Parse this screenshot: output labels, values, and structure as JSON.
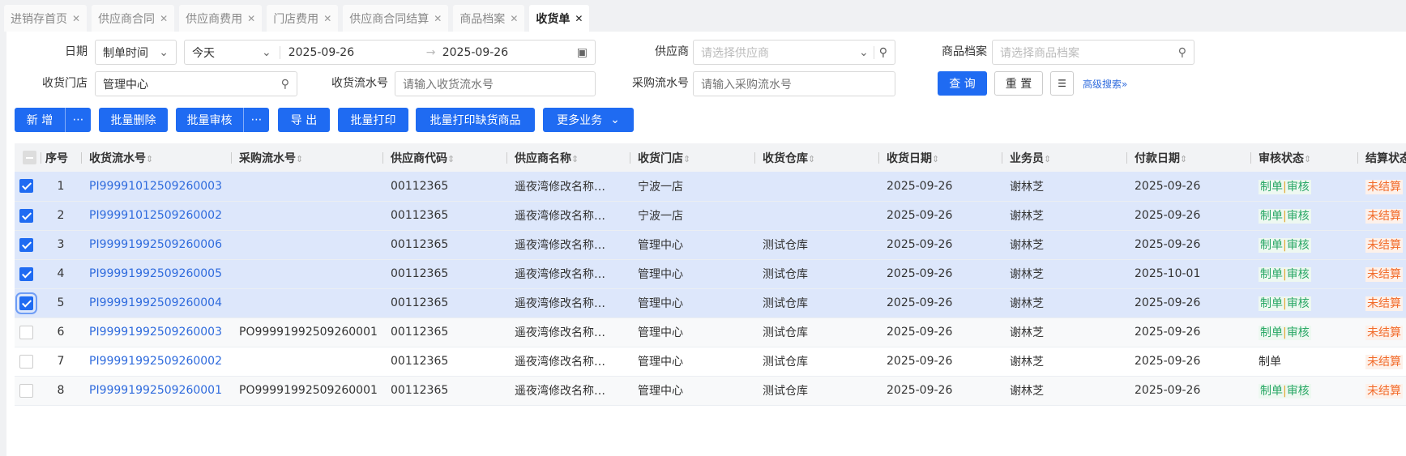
{
  "tabs": [
    {
      "label": "进销存首页",
      "active": false
    },
    {
      "label": "供应商合同",
      "active": false
    },
    {
      "label": "供应商费用",
      "active": false
    },
    {
      "label": "门店费用",
      "active": false
    },
    {
      "label": "供应商合同结算",
      "active": false
    },
    {
      "label": "商品档案",
      "active": false
    },
    {
      "label": "收货单",
      "active": true
    }
  ],
  "filters": {
    "date_label": "日期",
    "date_type": "制单时间",
    "date_preset": "今天",
    "date_start": "2025-09-26",
    "date_end": "2025-09-26",
    "supplier_label": "供应商",
    "supplier_placeholder": "请选择供应商",
    "product_label": "商品档案",
    "product_placeholder": "请选择商品档案",
    "store_label": "收货门店",
    "store_value": "管理中心",
    "receipt_no_label": "收货流水号",
    "receipt_no_placeholder": "请输入收货流水号",
    "purchase_no_label": "采购流水号",
    "purchase_no_placeholder": "请输入采购流水号",
    "query": "查 询",
    "reset": "重 置",
    "advanced": "高级搜索"
  },
  "toolbar": {
    "add": "新 增",
    "batch_delete": "批量删除",
    "batch_audit": "批量审核",
    "export": "导 出",
    "batch_print": "批量打印",
    "batch_print_shortage": "批量打印缺货商品",
    "more": "更多业务"
  },
  "table": {
    "columns": [
      "序号",
      "收货流水号",
      "采购流水号",
      "供应商代码",
      "供应商名称",
      "收货门店",
      "收货仓库",
      "收货日期",
      "业务员",
      "付款日期",
      "审核状态",
      "结算状态"
    ],
    "rows": [
      {
        "checked": true,
        "no": "1",
        "receipt": "PI99991012509260003",
        "purchase": "",
        "code": "00112365",
        "supplier": "遥夜湾修改名称…",
        "store": "宁波一店",
        "warehouse": "",
        "date": "2025-09-26",
        "clerk": "谢林芝",
        "pay_date": "2025-09-26",
        "audit_a": "制单",
        "audit_b": "审核",
        "settle": "未结算"
      },
      {
        "checked": true,
        "no": "2",
        "receipt": "PI99991012509260002",
        "purchase": "",
        "code": "00112365",
        "supplier": "遥夜湾修改名称…",
        "store": "宁波一店",
        "warehouse": "",
        "date": "2025-09-26",
        "clerk": "谢林芝",
        "pay_date": "2025-09-26",
        "audit_a": "制单",
        "audit_b": "审核",
        "settle": "未结算"
      },
      {
        "checked": true,
        "no": "3",
        "receipt": "PI99991992509260006",
        "purchase": "",
        "code": "00112365",
        "supplier": "遥夜湾修改名称…",
        "store": "管理中心",
        "warehouse": "测试仓库",
        "date": "2025-09-26",
        "clerk": "谢林芝",
        "pay_date": "2025-09-26",
        "audit_a": "制单",
        "audit_b": "审核",
        "settle": "未结算"
      },
      {
        "checked": true,
        "no": "4",
        "receipt": "PI99991992509260005",
        "purchase": "",
        "code": "00112365",
        "supplier": "遥夜湾修改名称…",
        "store": "管理中心",
        "warehouse": "测试仓库",
        "date": "2025-09-26",
        "clerk": "谢林芝",
        "pay_date": "2025-10-01",
        "audit_a": "制单",
        "audit_b": "审核",
        "settle": "未结算"
      },
      {
        "checked": true,
        "no": "5",
        "receipt": "PI99991992509260004",
        "purchase": "",
        "code": "00112365",
        "supplier": "遥夜湾修改名称…",
        "store": "管理中心",
        "warehouse": "测试仓库",
        "date": "2025-09-26",
        "clerk": "谢林芝",
        "pay_date": "2025-09-26",
        "audit_a": "制单",
        "audit_b": "审核",
        "settle": "未结算"
      },
      {
        "checked": false,
        "no": "6",
        "receipt": "PI99991992509260003",
        "purchase": "PO99991992509260001",
        "code": "00112365",
        "supplier": "遥夜湾修改名称…",
        "store": "管理中心",
        "warehouse": "测试仓库",
        "date": "2025-09-26",
        "clerk": "谢林芝",
        "pay_date": "2025-09-26",
        "audit_a": "制单",
        "audit_b": "审核",
        "settle": "未结算"
      },
      {
        "checked": false,
        "no": "7",
        "receipt": "PI99991992509260002",
        "purchase": "",
        "code": "00112365",
        "supplier": "遥夜湾修改名称…",
        "store": "管理中心",
        "warehouse": "测试仓库",
        "date": "2025-09-26",
        "clerk": "谢林芝",
        "pay_date": "2025-09-26",
        "audit_a": "制单",
        "audit_b": "",
        "settle": "未结算"
      },
      {
        "checked": false,
        "no": "8",
        "receipt": "PI99991992509260001",
        "purchase": "PO99991992509260001",
        "code": "00112365",
        "supplier": "遥夜湾修改名称…",
        "store": "管理中心",
        "warehouse": "测试仓库",
        "date": "2025-09-26",
        "clerk": "谢林芝",
        "pay_date": "2025-09-26",
        "audit_a": "制单",
        "audit_b": "审核",
        "settle": "未结算"
      }
    ]
  },
  "colors": {
    "primary": "#1f6bf2",
    "link": "#2f6bdd",
    "selected_row": "#dde7fb",
    "audit_green": "#2aa866",
    "settle_orange": "#f26b2a"
  }
}
